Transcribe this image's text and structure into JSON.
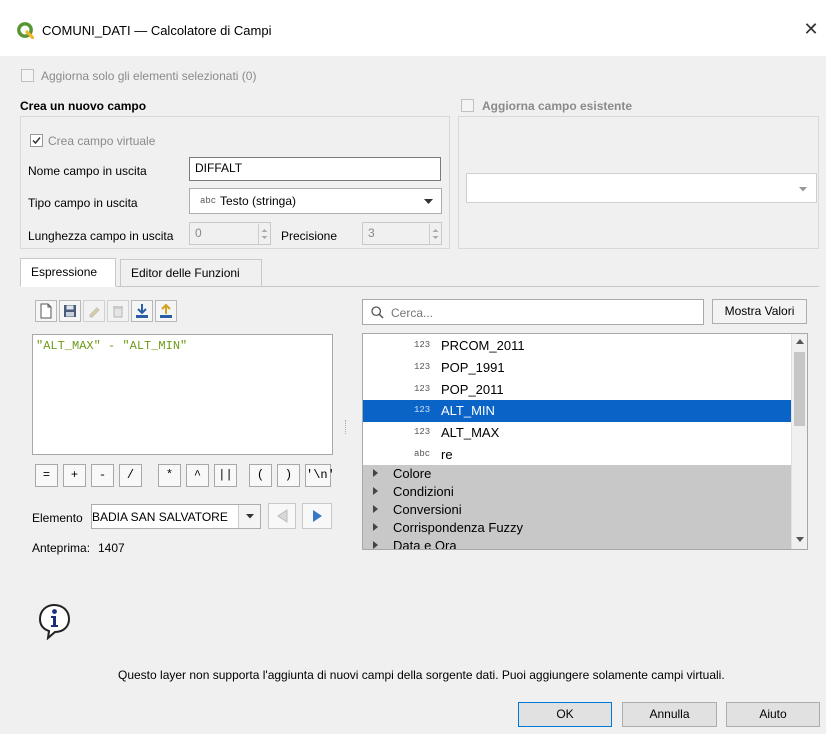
{
  "window": {
    "title": "COMUNI_DATI — Calcolatore di Campi",
    "close_glyph": "✕"
  },
  "update_selected": {
    "label": "Aggiorna solo gli elementi selezionati (0)",
    "checked": false
  },
  "new_field": {
    "header": "Crea un nuovo campo",
    "virtual_label": "Crea campo virtuale",
    "virtual_checked": true,
    "name_label": "Nome campo in uscita",
    "name_value": "DIFFALT",
    "type_label": "Tipo campo in uscita",
    "type_tag": "abc",
    "type_value": "Testo (stringa)",
    "length_label": "Lunghezza campo in uscita",
    "length_value": "0",
    "precision_label": "Precisione",
    "precision_value": "3"
  },
  "existing_field": {
    "header": "Aggiorna campo esistente",
    "checked": false,
    "value": ""
  },
  "tabs": [
    {
      "label": "Espressione",
      "active": true
    },
    {
      "label": "Editor delle Funzioni",
      "active": false
    }
  ],
  "toolbar_icons": [
    "new-file-icon",
    "save-icon",
    "edit-icon",
    "delete-icon",
    "download-icon",
    "upload-icon"
  ],
  "expression": "\"ALT_MAX\" - \"ALT_MIN\"",
  "operators": [
    "=",
    "+",
    "-",
    "/",
    "*",
    "^",
    "||",
    "(",
    ")",
    "'\\n'"
  ],
  "feature": {
    "label": "Elemento",
    "value": "BADIA SAN SALVATORE"
  },
  "preview": {
    "label": "Anteprima:",
    "value": "1407"
  },
  "search": {
    "placeholder": "Cerca...",
    "show_values": "Mostra Valori"
  },
  "fields_list": [
    {
      "tag": "123",
      "name": "PRCOM_2011",
      "selected": false
    },
    {
      "tag": "123",
      "name": "POP_1991",
      "selected": false
    },
    {
      "tag": "123",
      "name": "POP_2011",
      "selected": false
    },
    {
      "tag": "123",
      "name": "ALT_MIN",
      "selected": true
    },
    {
      "tag": "123",
      "name": "ALT_MAX",
      "selected": false
    },
    {
      "tag": "abc",
      "name": "re",
      "selected": false
    }
  ],
  "function_groups": [
    "Colore",
    "Condizioni",
    "Conversioni",
    "Corrispondenza Fuzzy",
    "Data e Ora"
  ],
  "info_message": "Questo layer non supporta l'aggiunta di nuovi campi della sorgente dati. Puoi aggiungere solamente campi virtuali.",
  "buttons": {
    "ok": "OK",
    "cancel": "Annulla",
    "help": "Aiuto"
  },
  "colors": {
    "selection": "#0a64c8",
    "expression_text": "#6f9a1a",
    "qgis_green": "#589632",
    "group_bg": "#c8c8c8"
  }
}
